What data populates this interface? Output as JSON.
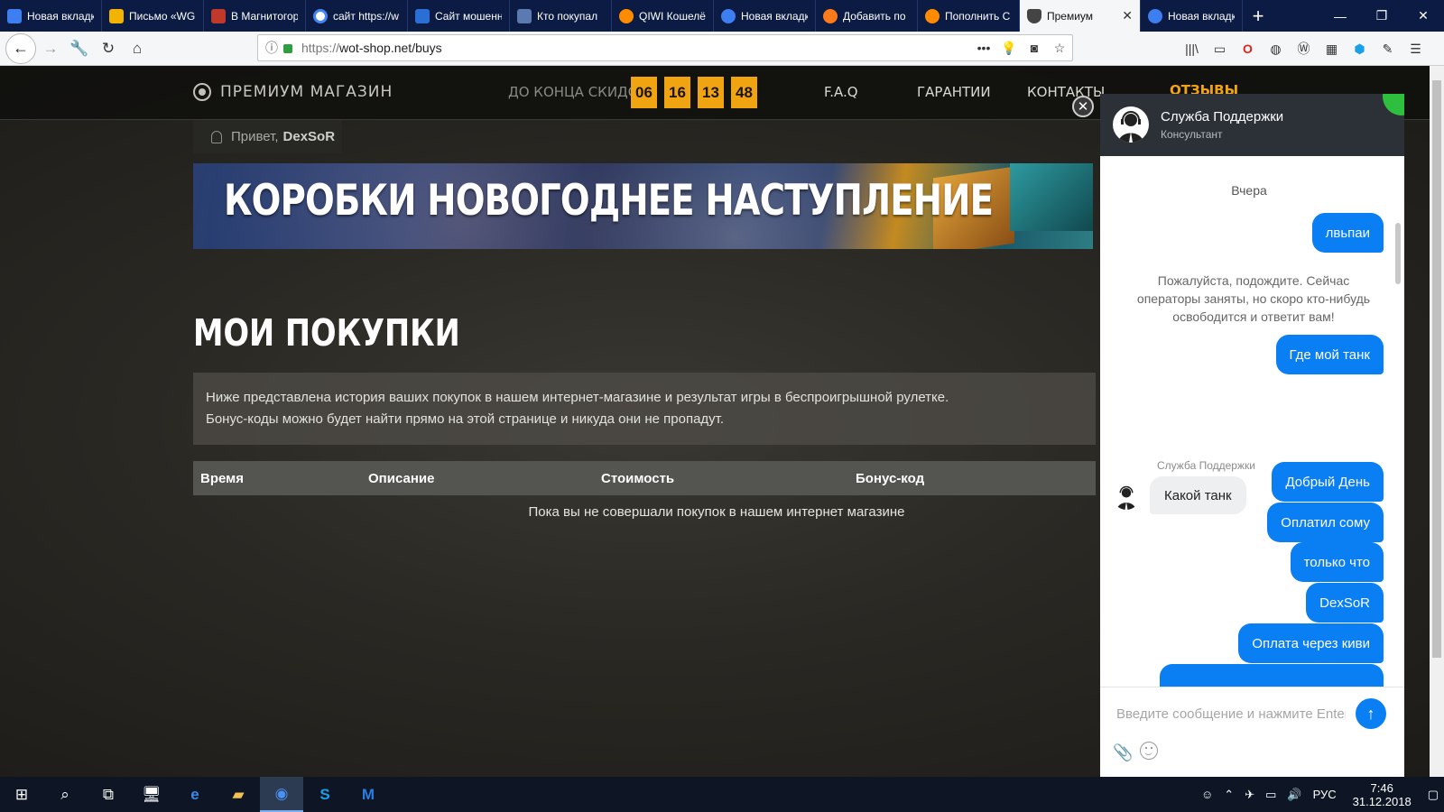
{
  "browser": {
    "tabs": [
      {
        "label": "Новая вкладка",
        "color": "#0b1b44"
      },
      {
        "label": "Письмо «WG",
        "color": "#f2b400"
      },
      {
        "label": "В Магнитогор",
        "color": "#c0392b"
      },
      {
        "label": "сайт https://w",
        "color": "#4285f4"
      },
      {
        "label": "Сайт мошенн",
        "color": "#2a6fd6"
      },
      {
        "label": "Кто покупал",
        "color": "#5a7ab0"
      },
      {
        "label": "QIWI Кошелё",
        "color": "#ff8c00"
      },
      {
        "label": "Новая вкладк",
        "color": "#3d7ef0"
      },
      {
        "label": "Добавить по",
        "color": "#ff7a1a"
      },
      {
        "label": "Пополнить С",
        "color": "#ff8c00"
      },
      {
        "label": "Премиум",
        "color": "#444444"
      },
      {
        "label": "Новая вкладк",
        "color": "#3d7ef0"
      }
    ],
    "url_proto": "https://",
    "url_rest": "wot-shop.net/buys"
  },
  "site": {
    "logo": "ПРЕМИУМ МАГАЗИН",
    "timer_label": "ДО КОНЦА СКИДОК:",
    "timer": [
      "06",
      "16",
      "13",
      "48"
    ],
    "menu": [
      "F.A.Q",
      "ГАРАНТИИ",
      "КОНТАКТЫ",
      "ОТЗЫВЫ"
    ],
    "greeting": "Привет,",
    "username": "DexSoR",
    "banner": "КОРОБКИ НОВОГОДНЕЕ НАСТУПЛЕНИЕ",
    "heading": "МОИ ПОКУПКИ",
    "info_line1": "Ниже представлена история ваших покупок в нашем интернет-магазине и результат игры в беспроигрышной рулетке.",
    "info_line2": "Бонус-коды можно будет найти прямо на этой странице и никуда они не пропадут.",
    "table_headers": [
      "Время",
      "Описание",
      "Стоимость",
      "Бонус-код"
    ],
    "empty_text": "Пока вы не совершали покупок в нашем интернет магазине"
  },
  "chat": {
    "title": "Служба Поддержки",
    "subtitle": "Консультант",
    "day": "Вчера",
    "messages_out": [
      "лвьпаи",
      "Где мой танк",
      "Добрый День",
      "Оплатил сому",
      "только что",
      "DexSoR",
      "Оплата через киви"
    ],
    "system_msg": "Пожалуйста, подождите. Сейчас операторы заняты, но скоро кто-нибудь освободится и ответит вам!",
    "agent_name": "Служба Поддержки",
    "agent_msg": "Какой танк",
    "input_placeholder": "Введите сообщение и нажмите Enter"
  },
  "taskbar": {
    "lang": "РУС",
    "time": "7:46",
    "date": "31.12.2018"
  }
}
